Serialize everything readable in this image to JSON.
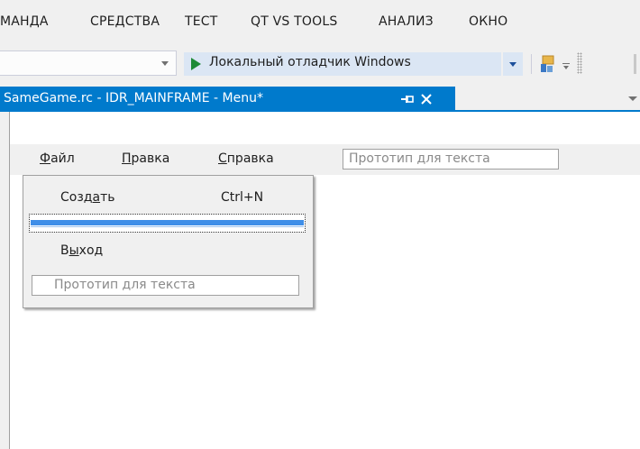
{
  "menubar": {
    "items": [
      "МАНДА",
      "СРЕДСТВА",
      "ТЕСТ",
      "QT VS TOOLS",
      "АНАЛИЗ",
      "ОКНО"
    ]
  },
  "toolbar": {
    "debugger_label": "Локальный отладчик Windows"
  },
  "document_tab": {
    "title": "SameGame.rc - IDR_MAINFRAME - Menu*"
  },
  "menu_designer": {
    "top_items": [
      {
        "pre": "",
        "mnemonic": "Ф",
        "post": "айл"
      },
      {
        "pre": "",
        "mnemonic": "П",
        "post": "равка"
      },
      {
        "pre": "",
        "mnemonic": "С",
        "post": "правка"
      }
    ],
    "type_here": "Прототип для текста",
    "popup": {
      "items": [
        {
          "pre": "Созд",
          "mnemonic": "а",
          "post": "ть",
          "shortcut": "Ctrl+N"
        },
        {
          "pre": "В",
          "mnemonic": "ы",
          "post": "ход",
          "shortcut": ""
        }
      ],
      "type_here": "Прототип для текста"
    }
  },
  "colors": {
    "accent": "#007acc",
    "debug_play": "#1e8a36",
    "separator_selected": "#3f8ee8"
  }
}
